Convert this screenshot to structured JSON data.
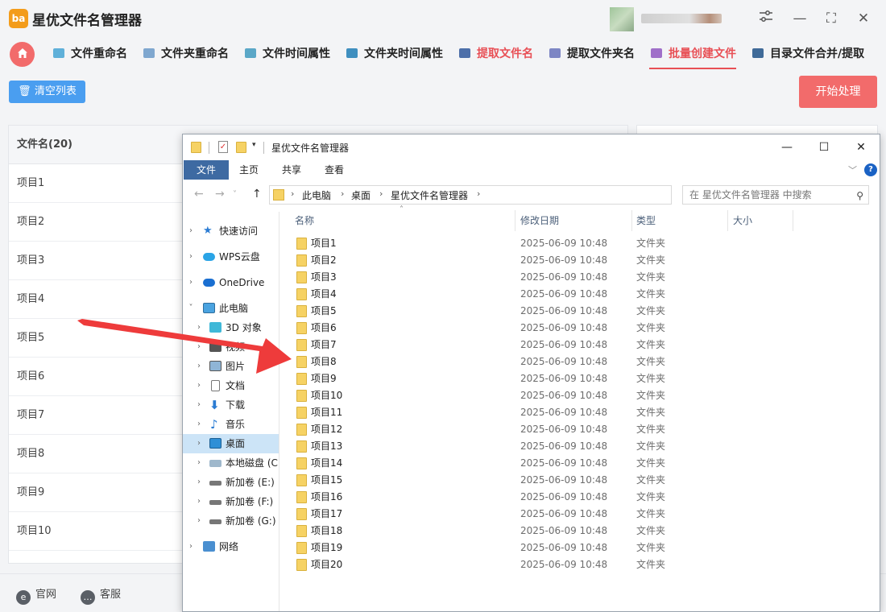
{
  "app": {
    "title": "星优文件名管理器",
    "logo_text": "ba",
    "logo_icon": "app-logo-icon",
    "window_controls": {
      "settings_icon": "sliders-icon",
      "minimize": "—",
      "maximize": "⛶",
      "close": "✕"
    }
  },
  "nav": {
    "home_icon": "home-icon",
    "tabs": [
      {
        "label": "文件重命名",
        "icon_color": "#5fb0d9"
      },
      {
        "label": "文件夹重命名",
        "icon_color": "#7fa7cf"
      },
      {
        "label": "文件时间属性",
        "icon_color": "#5aa7c7"
      },
      {
        "label": "文件夹时间属性",
        "icon_color": "#3f8fbf"
      },
      {
        "label": "提取文件名",
        "icon_color": "#4d6fa9"
      },
      {
        "label": "提取文件夹名",
        "icon_color": "#7d86c4"
      },
      {
        "label": "批量创建文件",
        "icon_color": "#9f6fc9"
      },
      {
        "label": "目录文件合并/提取",
        "icon_color": "#3f6a98"
      }
    ],
    "active_tab": "批量创建文件"
  },
  "actions": {
    "clear_label": "清空列表",
    "start_label": "开始处理"
  },
  "list": {
    "header": "文件名(20)",
    "rows": [
      "项目1",
      "项目2",
      "项目3",
      "项目4",
      "项目5",
      "项目6",
      "项目7",
      "项目8",
      "项目9",
      "项目10"
    ]
  },
  "footer": {
    "website_label": "官网",
    "service_label": "客服"
  },
  "explorer": {
    "title": "星优文件名管理器",
    "ribbon": {
      "file": "文件",
      "tabs": [
        "主页",
        "共享",
        "查看"
      ]
    },
    "breadcrumbs": [
      "此电脑",
      "桌面",
      "星优文件名管理器"
    ],
    "search_placeholder": "在 星优文件名管理器 中搜索",
    "nav_items": [
      {
        "label": "快速访问",
        "icon": "star-icon"
      },
      {
        "label": "WPS云盘",
        "icon": "cloud-icon"
      },
      {
        "label": "OneDrive",
        "icon": "onedrive-icon"
      },
      {
        "label": "此电脑",
        "icon": "computer-icon"
      },
      {
        "label": "3D 对象",
        "icon": "cube-icon"
      },
      {
        "label": "视频",
        "icon": "video-icon"
      },
      {
        "label": "图片",
        "icon": "picture-icon"
      },
      {
        "label": "文档",
        "icon": "document-icon"
      },
      {
        "label": "下载",
        "icon": "download-icon"
      },
      {
        "label": "音乐",
        "icon": "music-icon"
      },
      {
        "label": "桌面",
        "icon": "desktop-icon"
      },
      {
        "label": "本地磁盘 (C",
        "icon": "disk-icon"
      },
      {
        "label": "新加卷 (E:)",
        "icon": "drive-icon"
      },
      {
        "label": "新加卷 (F:)",
        "icon": "drive-icon"
      },
      {
        "label": "新加卷 (G:)",
        "icon": "drive-icon"
      },
      {
        "label": "网络",
        "icon": "network-icon"
      }
    ],
    "selected_nav": "桌面",
    "columns": {
      "name": "名称",
      "date": "修改日期",
      "type": "类型",
      "size": "大小"
    },
    "files": [
      {
        "name": "项目1",
        "date": "2025-06-09 10:48",
        "type": "文件夹"
      },
      {
        "name": "项目2",
        "date": "2025-06-09 10:48",
        "type": "文件夹"
      },
      {
        "name": "项目3",
        "date": "2025-06-09 10:48",
        "type": "文件夹"
      },
      {
        "name": "项目4",
        "date": "2025-06-09 10:48",
        "type": "文件夹"
      },
      {
        "name": "项目5",
        "date": "2025-06-09 10:48",
        "type": "文件夹"
      },
      {
        "name": "项目6",
        "date": "2025-06-09 10:48",
        "type": "文件夹"
      },
      {
        "name": "项目7",
        "date": "2025-06-09 10:48",
        "type": "文件夹"
      },
      {
        "name": "项目8",
        "date": "2025-06-09 10:48",
        "type": "文件夹"
      },
      {
        "name": "项目9",
        "date": "2025-06-09 10:48",
        "type": "文件夹"
      },
      {
        "name": "项目10",
        "date": "2025-06-09 10:48",
        "type": "文件夹"
      },
      {
        "name": "项目11",
        "date": "2025-06-09 10:48",
        "type": "文件夹"
      },
      {
        "name": "项目12",
        "date": "2025-06-09 10:48",
        "type": "文件夹"
      },
      {
        "name": "项目13",
        "date": "2025-06-09 10:48",
        "type": "文件夹"
      },
      {
        "name": "项目14",
        "date": "2025-06-09 10:48",
        "type": "文件夹"
      },
      {
        "name": "项目15",
        "date": "2025-06-09 10:48",
        "type": "文件夹"
      },
      {
        "name": "项目16",
        "date": "2025-06-09 10:48",
        "type": "文件夹"
      },
      {
        "name": "项目17",
        "date": "2025-06-09 10:48",
        "type": "文件夹"
      },
      {
        "name": "项目18",
        "date": "2025-06-09 10:48",
        "type": "文件夹"
      },
      {
        "name": "项目19",
        "date": "2025-06-09 10:48",
        "type": "文件夹"
      },
      {
        "name": "项目20",
        "date": "2025-06-09 10:48",
        "type": "文件夹"
      }
    ]
  },
  "colors": {
    "accent_red": "#f26b6b",
    "accent_blue": "#4a9ef0",
    "explorer_file_tab": "#3e6aa2",
    "arrow": "#ee3b3b"
  }
}
